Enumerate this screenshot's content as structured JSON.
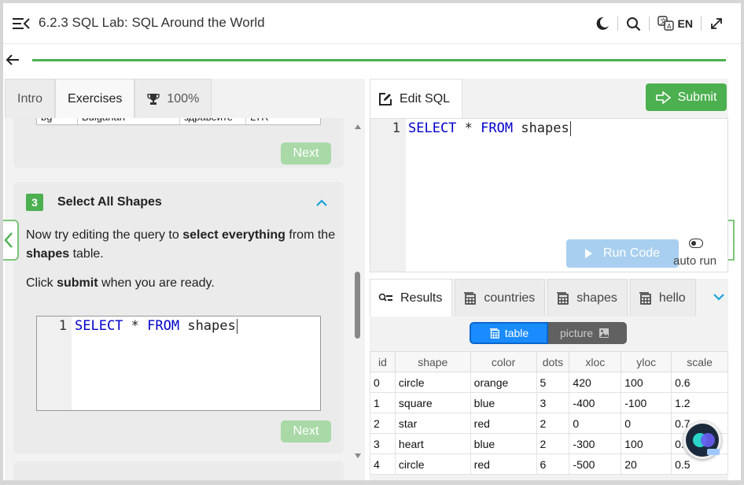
{
  "header": {
    "title": "6.2.3 SQL Lab: SQL Around the World",
    "language": "EN"
  },
  "progress": {
    "percent": 100,
    "color": "#4cb050"
  },
  "left_tabs": [
    {
      "label": "Intro"
    },
    {
      "label": "Exercises"
    },
    {
      "label": "100%"
    }
  ],
  "prev_card": {
    "row": [
      "bg",
      "Bulgarian",
      "здравейте",
      "LTR"
    ],
    "next_label": "Next"
  },
  "step": {
    "number": "3",
    "title": "Select All Shapes",
    "instr_a": "Now try editing the query to ",
    "instr_b": "select everything",
    "instr_c": " from the ",
    "instr_d": "shapes",
    "instr_e": " table.",
    "click_a": "Click ",
    "click_b": "submit",
    "click_c": " when you are ready.",
    "code_line_no": "1",
    "code_kw1": "SELECT",
    "code_mid": " * ",
    "code_kw2": "FROM",
    "code_rest": " shapes",
    "next_label": "Next"
  },
  "editor": {
    "tab_label": "Edit SQL",
    "submit_label": "Submit",
    "line_no": "1",
    "kw1": "SELECT",
    "mid": " * ",
    "kw2": "FROM",
    "rest": " shapes",
    "run_label": "Run Code",
    "auto_run_label": "auto run"
  },
  "results": {
    "tabs": [
      {
        "label": "Results"
      },
      {
        "label": "countries"
      },
      {
        "label": "shapes"
      },
      {
        "label": "hello"
      }
    ],
    "view_table": "table",
    "view_picture": "picture",
    "columns": [
      "id",
      "shape",
      "color",
      "dots",
      "xloc",
      "yloc",
      "scale"
    ],
    "rows": [
      [
        "0",
        "circle",
        "orange",
        "5",
        "420",
        "100",
        "0.6"
      ],
      [
        "1",
        "square",
        "blue",
        "3",
        "-400",
        "-100",
        "1.2"
      ],
      [
        "2",
        "star",
        "red",
        "2",
        "0",
        "0",
        "0.7"
      ],
      [
        "3",
        "heart",
        "blue",
        "2",
        "-300",
        "100",
        "0."
      ],
      [
        "4",
        "circle",
        "red",
        "6",
        "-500",
        "20",
        "0.5"
      ]
    ]
  },
  "colors": {
    "accent_green": "#4cb050",
    "run_blue": "#a9cff0",
    "toggle_blue": "#1a8cff",
    "sql_keyword": "#0000cc"
  }
}
